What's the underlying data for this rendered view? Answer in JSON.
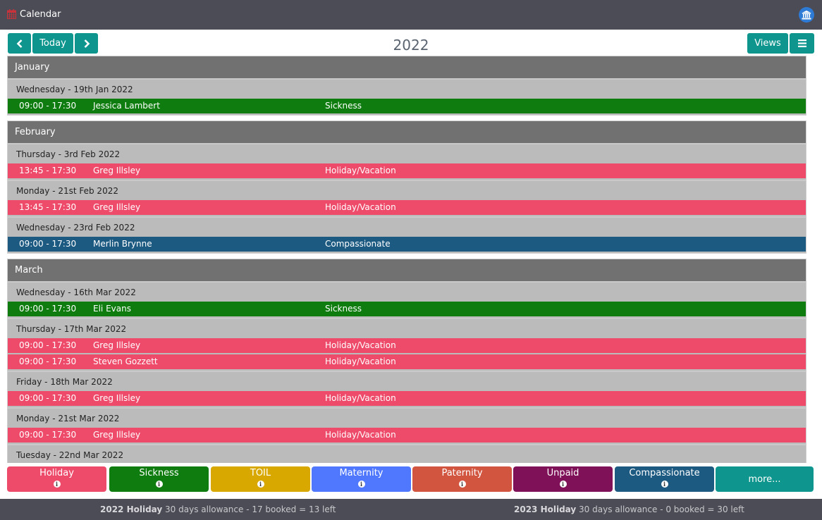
{
  "app": {
    "title": "Calendar",
    "icons": {
      "calendar": "calendar-icon",
      "bank": "bank-icon"
    }
  },
  "toolbar": {
    "prev_label": "‹",
    "today_label": "Today",
    "next_label": "›",
    "year": "2022",
    "views_label": "Views",
    "menu_label": "≡"
  },
  "colors": {
    "Sickness": "#0e7c0e",
    "Holiday/Vacation": "#ee4a6a",
    "Compassionate": "#1c5a82"
  },
  "months": [
    {
      "name": "January",
      "days": [
        {
          "date": "Wednesday - 19th Jan 2022",
          "entries": [
            {
              "time": "09:00 - 17:30",
              "name": "Jessica Lambert",
              "type": "Sickness"
            }
          ]
        }
      ]
    },
    {
      "name": "February",
      "days": [
        {
          "date": "Thursday - 3rd Feb 2022",
          "entries": [
            {
              "time": "13:45 - 17:30",
              "name": "Greg Illsley",
              "type": "Holiday/Vacation"
            }
          ]
        },
        {
          "date": "Monday - 21st Feb 2022",
          "entries": [
            {
              "time": "13:45 - 17:30",
              "name": "Greg Illsley",
              "type": "Holiday/Vacation"
            }
          ]
        },
        {
          "date": "Wednesday - 23rd Feb 2022",
          "entries": [
            {
              "time": "09:00 - 17:30",
              "name": "Merlin Brynne",
              "type": "Compassionate"
            }
          ]
        }
      ]
    },
    {
      "name": "March",
      "days": [
        {
          "date": "Wednesday - 16th Mar 2022",
          "entries": [
            {
              "time": "09:00 - 17:30",
              "name": "Eli Evans",
              "type": "Sickness"
            }
          ]
        },
        {
          "date": "Thursday - 17th Mar 2022",
          "entries": [
            {
              "time": "09:00 - 17:30",
              "name": "Greg Illsley",
              "type": "Holiday/Vacation"
            },
            {
              "time": "09:00 - 17:30",
              "name": "Steven Gozzett",
              "type": "Holiday/Vacation"
            }
          ]
        },
        {
          "date": "Friday - 18th Mar 2022",
          "entries": [
            {
              "time": "09:00 - 17:30",
              "name": "Greg Illsley",
              "type": "Holiday/Vacation"
            }
          ]
        },
        {
          "date": "Monday - 21st Mar 2022",
          "entries": [
            {
              "time": "09:00 - 17:30",
              "name": "Greg Illsley",
              "type": "Holiday/Vacation"
            }
          ]
        },
        {
          "date": "Tuesday - 22nd Mar 2022",
          "entries": []
        }
      ]
    }
  ],
  "legend": [
    {
      "label": "Holiday",
      "color": "#ee4a6a",
      "icon": "info-icon"
    },
    {
      "label": "Sickness",
      "color": "#0e7c0e",
      "icon": "info-icon"
    },
    {
      "label": "TOIL",
      "color": "#d8a800",
      "icon": "info-icon"
    },
    {
      "label": "Maternity",
      "color": "#5078ff",
      "icon": "info-icon"
    },
    {
      "label": "Paternity",
      "color": "#d25540",
      "icon": "info-icon"
    },
    {
      "label": "Unpaid",
      "color": "#7f1158",
      "icon": "info-icon"
    },
    {
      "label": "Compassionate",
      "color": "#1c5a82",
      "icon": "info-icon"
    },
    {
      "label": "more...",
      "color": "#0e958e",
      "icon": null
    }
  ],
  "footer": {
    "y2022": {
      "heading": "2022 Holiday",
      "text": " 30 days allowance - 17 booked = 13 left"
    },
    "y2023": {
      "heading": "2023 Holiday",
      "text": " 30 days allowance - 0 booked = 30 left"
    }
  }
}
